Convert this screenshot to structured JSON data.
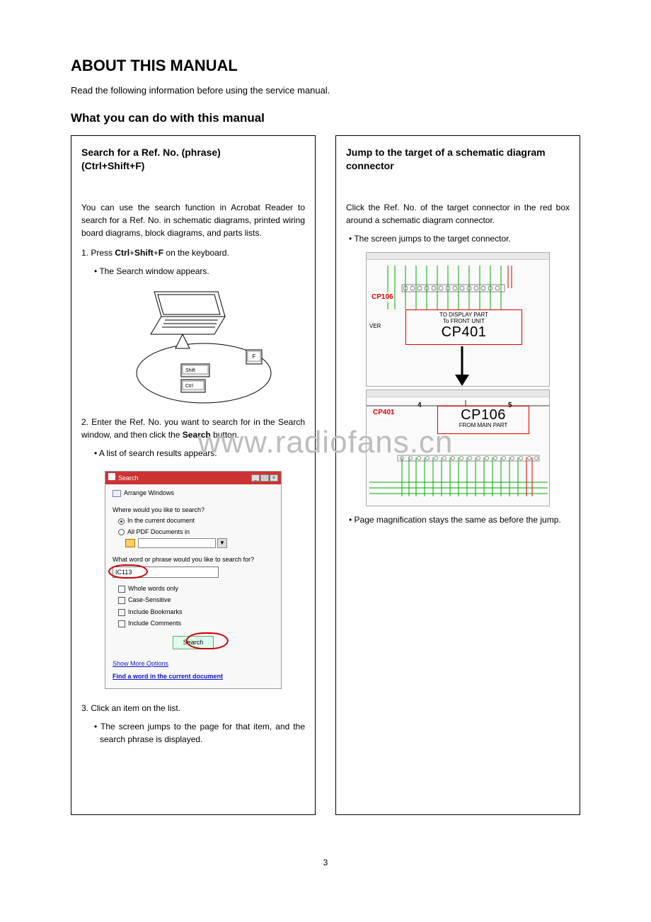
{
  "title": "ABOUT THIS MANUAL",
  "intro": "Read the following information before using the service manual.",
  "subtitle": "What you can do with this manual",
  "watermark": "www.radiofans.cn",
  "page_number": "3",
  "left": {
    "heading_line1": "Search for a Ref. No. (phrase)",
    "heading_line2": "(Ctrl+Shift+F)",
    "para1": "You can use the search function in Acrobat Reader to search for a Ref. No. in schematic diagrams, printed wiring board diagrams, block diagrams, and parts lists.",
    "step1_a": "1. Press ",
    "step1_b": "Ctrl",
    "step1_plus1": "+",
    "step1_c": "Shift",
    "step1_plus2": "+",
    "step1_d": "F",
    "step1_e": " on the keyboard.",
    "step1_sub": "The Search window appears.",
    "key_f": "F",
    "key_shift": "Shift",
    "key_ctrl": "Ctrl",
    "step2_a": "2. Enter the Ref. No. you want to search for in the Search window, and then click the ",
    "step2_b": "Search",
    "step2_c": " button.",
    "step2_sub": "A list of search results appears.",
    "search_window": {
      "title": "Search",
      "arrange": "Arrange Windows",
      "where_label": "Where would you like to search?",
      "radio1": "In the current document",
      "radio2": "All PDF Documents in",
      "what_label": "What word or phrase would you like to search for?",
      "input_value": "IC113",
      "chk1": "Whole words only",
      "chk2": "Case-Sensitive",
      "chk3": "Include Bookmarks",
      "chk4": "Include Comments",
      "search_btn": "Search",
      "link1": "Show More Options",
      "link2": "Find a word in the current document"
    },
    "step3_a": "3. Click an item on the list.",
    "step3_sub": "The screen jumps to the page for that item, and the search phrase is displayed."
  },
  "right": {
    "heading": "Jump to the target of a schematic diagram connector",
    "para1": "Click the Ref. No. of the target connector in the red box around a schematic diagram connector.",
    "bullet1": "The screen jumps to the target connector.",
    "schem": {
      "cp106": "CP106",
      "ver": "VER",
      "to_display1": "TO DISPLAY PART",
      "to_display2": "To FRONT UNIT",
      "cp401_big": "CP401",
      "cp401_small": "CP401",
      "cp106_big": "CP106",
      "from_main": "FROM MAIN PART",
      "axis4": "4",
      "axis5": "5"
    },
    "bullet2": "Page magnification stays the same as before the jump."
  }
}
